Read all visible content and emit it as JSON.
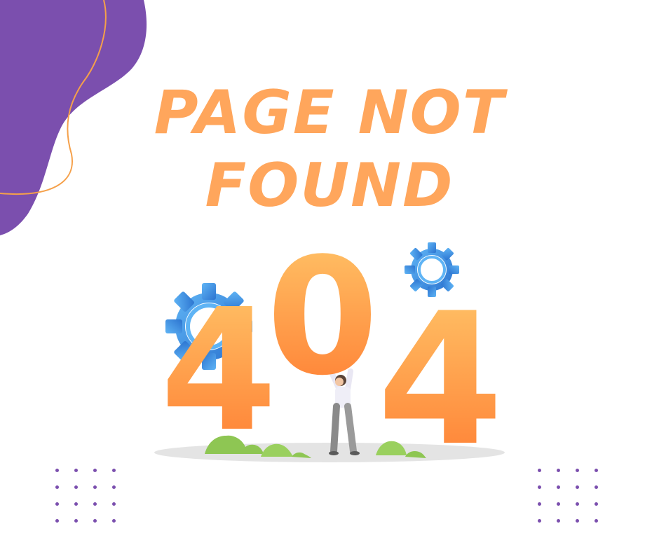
{
  "headline": {
    "line1": "PAGE NOT",
    "line2": "FOUND"
  },
  "error_code": {
    "digit_left": "4",
    "digit_middle": "0",
    "digit_right": "4"
  },
  "colors": {
    "headline": "#ffa65c",
    "blob": "#7b4fae",
    "blob_outline": "#f5a04a",
    "digit_top": "#ffc76a",
    "digit_bottom": "#ff7a30",
    "gear": "#3a8fe0",
    "bush": "#8ec653",
    "ground": "#e4e4e4",
    "dots": "#7b4fae"
  },
  "icons": [
    "gear-icon",
    "gear-icon",
    "person-illustration",
    "bush-icon"
  ]
}
